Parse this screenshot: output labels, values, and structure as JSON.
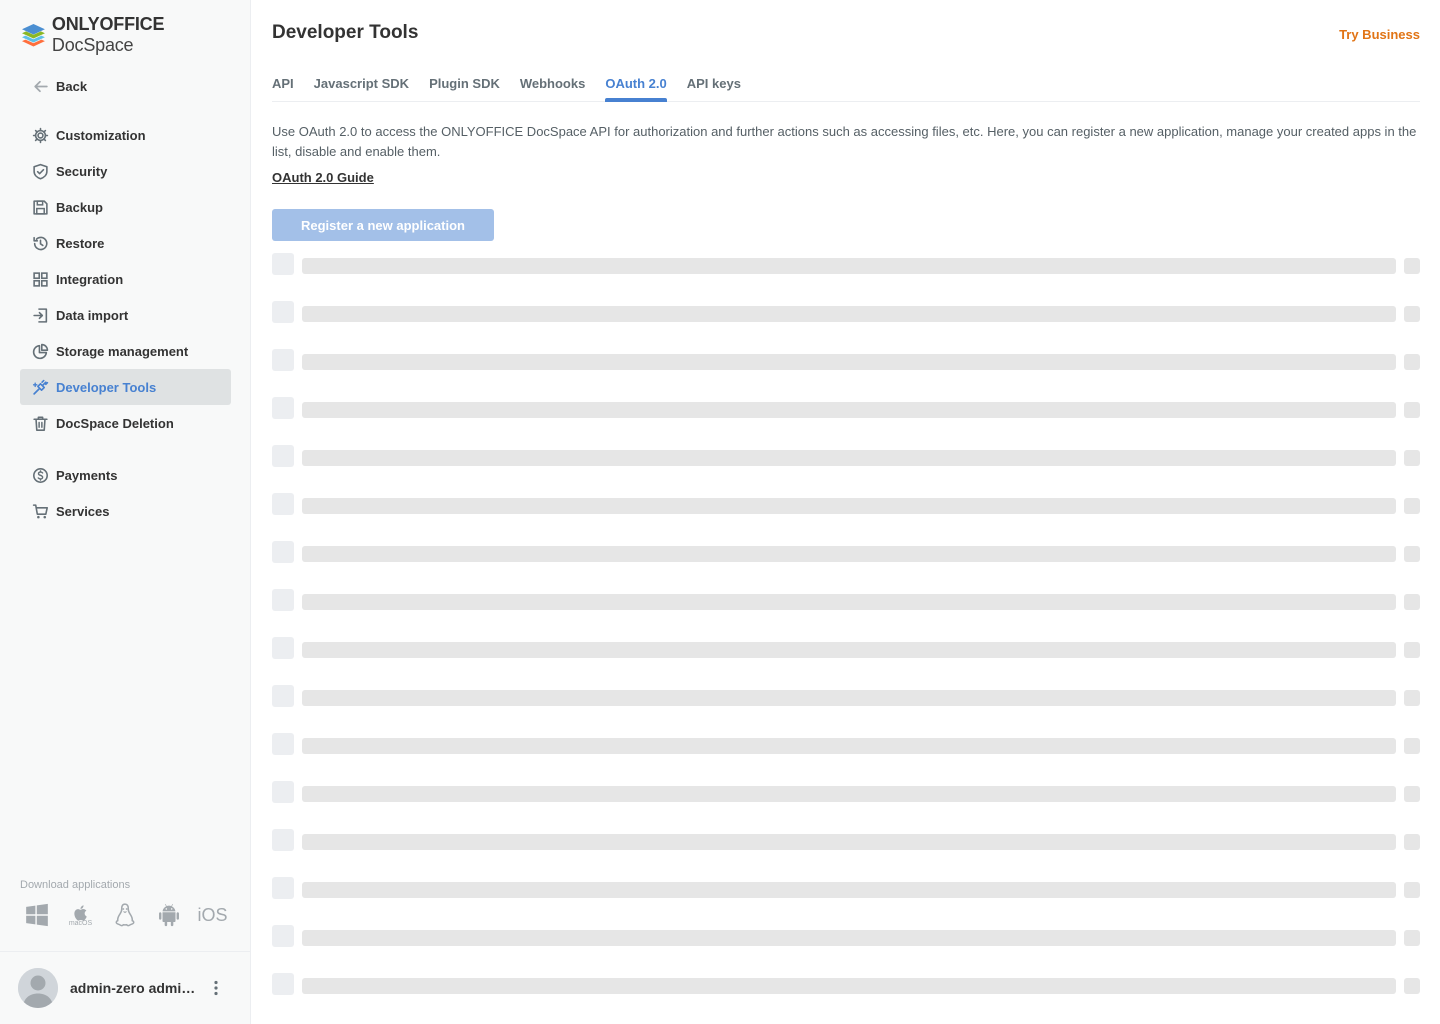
{
  "brand": {
    "name_bold": "ONLYOFFICE",
    "name_light": "DocSpace"
  },
  "sidebar": {
    "back_label": "Back",
    "items": [
      {
        "label": "Customization",
        "icon": "gear-icon"
      },
      {
        "label": "Security",
        "icon": "shield-icon"
      },
      {
        "label": "Backup",
        "icon": "save-icon"
      },
      {
        "label": "Restore",
        "icon": "history-icon"
      },
      {
        "label": "Integration",
        "icon": "grid-icon"
      },
      {
        "label": "Data import",
        "icon": "import-icon"
      },
      {
        "label": "Storage management",
        "icon": "pie-chart-icon"
      },
      {
        "label": "Developer Tools",
        "icon": "developer-tools-icon",
        "active": true
      },
      {
        "label": "DocSpace Deletion",
        "icon": "trash-icon"
      },
      {
        "label": "Payments",
        "icon": "payments-icon"
      },
      {
        "label": "Services",
        "icon": "cart-icon"
      }
    ],
    "downloads_title": "Download applications",
    "download_apps": [
      "windows-icon",
      "macos-icon",
      "linux-icon",
      "android-icon",
      "ios-icon"
    ],
    "macos_label": "macOS",
    "ios_label": "iOS"
  },
  "profile": {
    "name": "admin-zero admin-zero"
  },
  "header": {
    "title": "Developer Tools",
    "try_business": "Try Business"
  },
  "tabs": [
    {
      "label": "API"
    },
    {
      "label": "Javascript SDK"
    },
    {
      "label": "Plugin SDK"
    },
    {
      "label": "Webhooks"
    },
    {
      "label": "OAuth 2.0",
      "active": true
    },
    {
      "label": "API keys"
    }
  ],
  "content": {
    "description": "Use OAuth 2.0 to access the ONLYOFFICE DocSpace API for authorization and further actions such as accessing files, etc. Here, you can register a new application, manage your created apps in the list, disable and enable them.",
    "guide_link": "OAuth 2.0 Guide",
    "register_button": "Register a new application",
    "loading_rows": 16
  },
  "colors": {
    "accent": "#4781d1",
    "try_business": "#e17415",
    "button_disabled": "#a3c0e8",
    "skeleton": "#e6e6e6"
  }
}
